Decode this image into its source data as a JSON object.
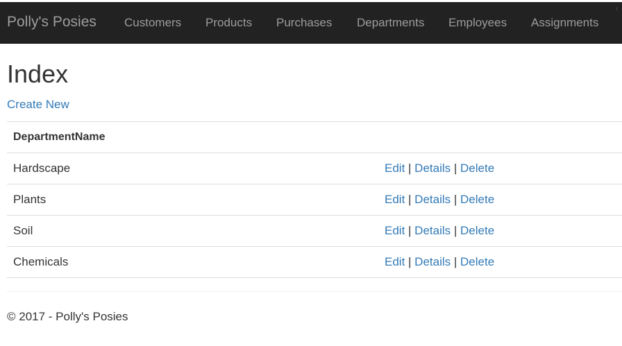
{
  "nav": {
    "brand": "Polly's Posies",
    "items": [
      {
        "label": "Customers"
      },
      {
        "label": "Products"
      },
      {
        "label": "Purchases"
      },
      {
        "label": "Departments"
      },
      {
        "label": "Employees"
      },
      {
        "label": "Assignments"
      }
    ],
    "collapse_icon": "chevron-left-icon"
  },
  "main": {
    "title": "Index",
    "create_link": "Create New",
    "table": {
      "header": "DepartmentName",
      "action_labels": {
        "edit": "Edit",
        "details": "Details",
        "delete": "Delete",
        "separator": "|"
      },
      "rows": [
        {
          "name": "Hardscape"
        },
        {
          "name": "Plants"
        },
        {
          "name": "Soil"
        },
        {
          "name": "Chemicals"
        }
      ]
    }
  },
  "footer": {
    "text": "© 2017 - Polly's Posies"
  },
  "colors": {
    "navbar_bg": "#222222",
    "nav_text": "#9d9d9d",
    "link": "#337ab7",
    "text": "#333333",
    "border": "#dddddd"
  }
}
